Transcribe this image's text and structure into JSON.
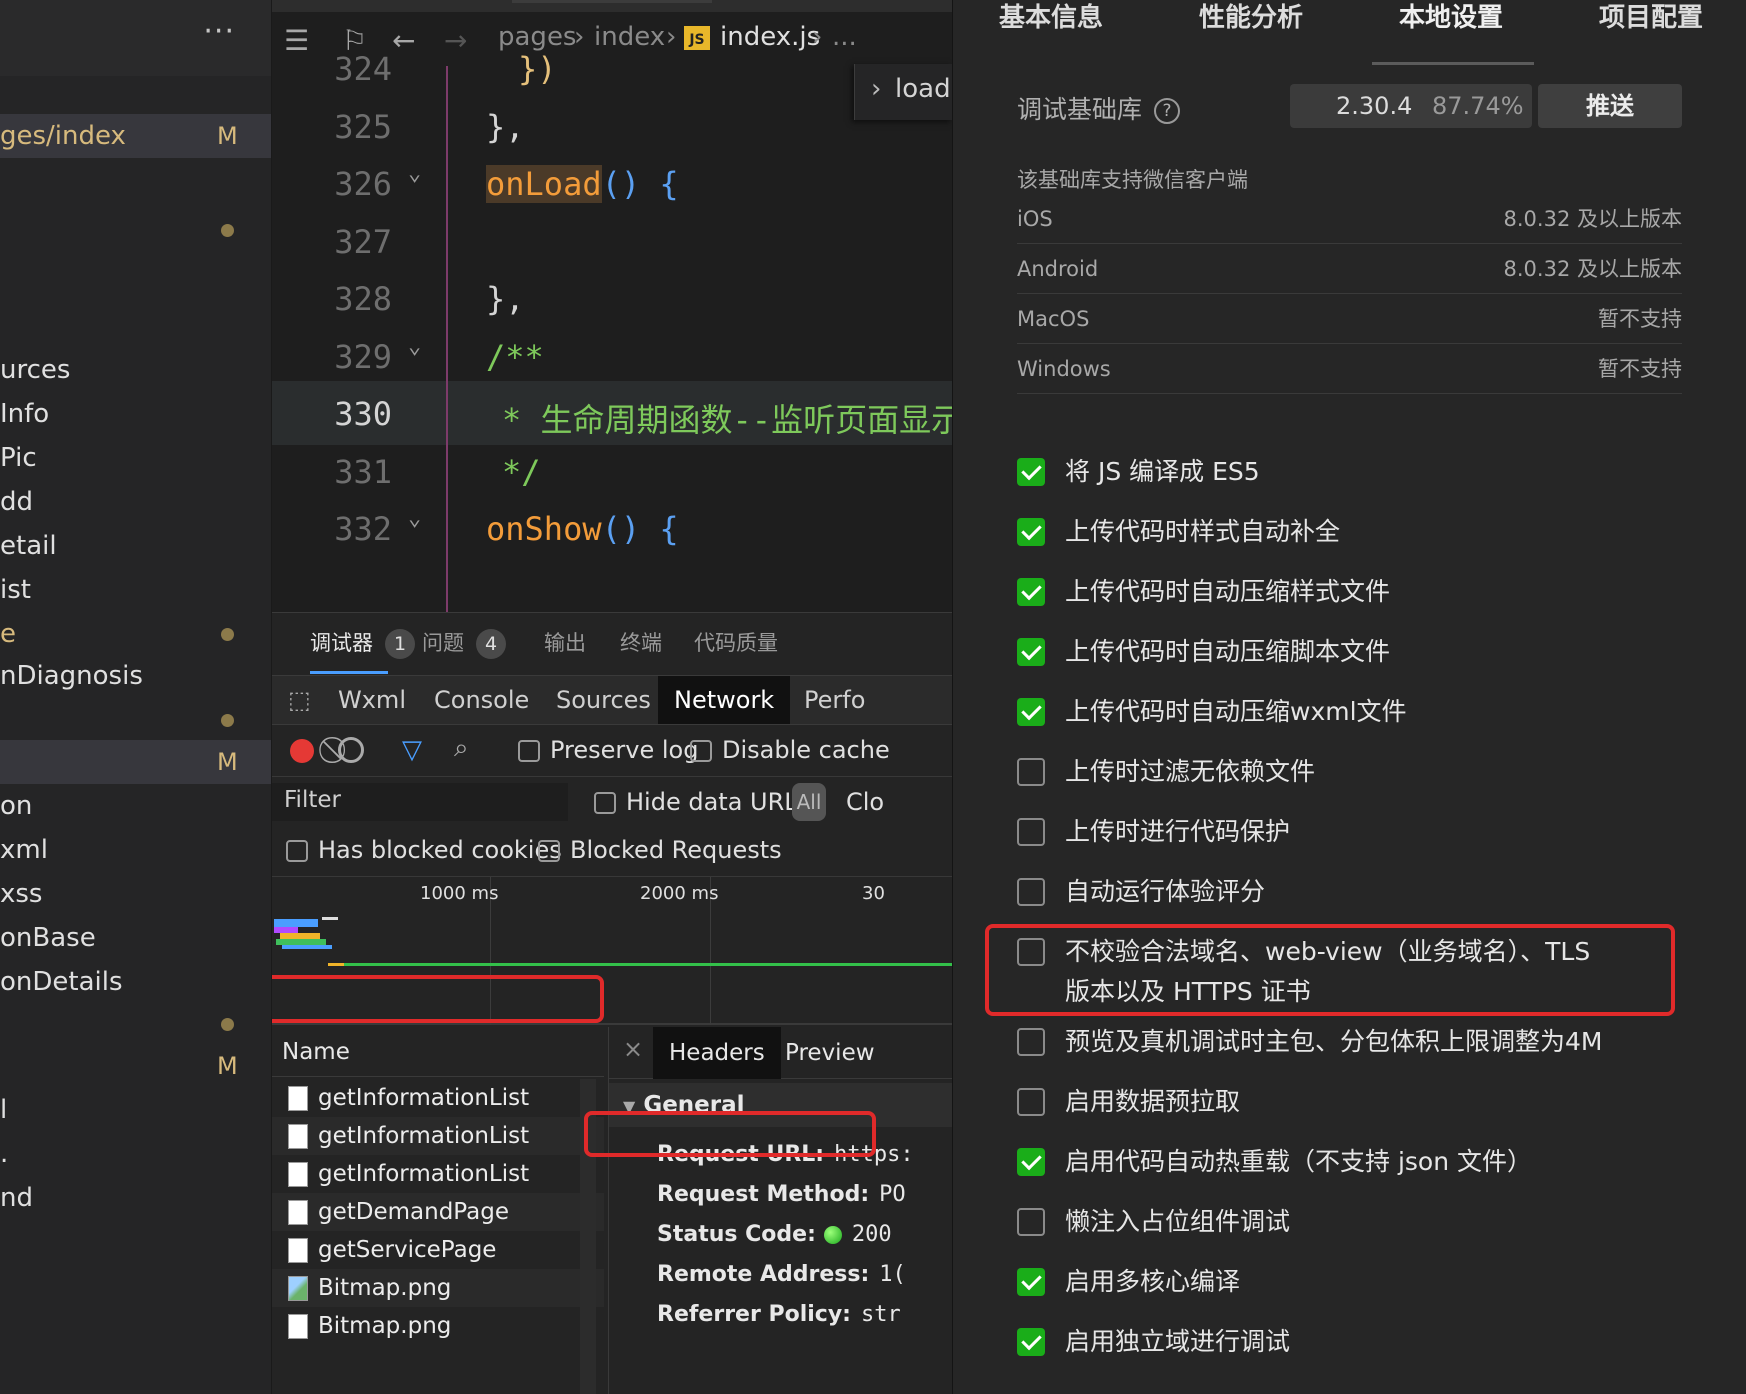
{
  "explorer": {
    "items": [
      {
        "label": "ges/index",
        "tag": "M",
        "dot": false,
        "highlight": true
      },
      {
        "label": "",
        "tag": "",
        "dot": true,
        "highlight": false
      },
      {
        "label": "urces",
        "tag": "",
        "dot": false
      },
      {
        "label": "Info",
        "tag": "",
        "dot": false
      },
      {
        "label": "Pic",
        "tag": "",
        "dot": false
      },
      {
        "label": "dd",
        "tag": "",
        "dot": false
      },
      {
        "label": "etail",
        "tag": "",
        "dot": false
      },
      {
        "label": "ist",
        "tag": "",
        "dot": false
      },
      {
        "label": "e",
        "tag": "",
        "dot": true
      },
      {
        "label": "nDiagnosis",
        "tag": "",
        "dot": false
      },
      {
        "label": "",
        "tag": "",
        "dot": true
      },
      {
        "label": "",
        "tag": "M",
        "dot": false,
        "highlight": true
      },
      {
        "label": "on",
        "tag": "",
        "dot": false
      },
      {
        "label": "xml",
        "tag": "",
        "dot": false
      },
      {
        "label": "xss",
        "tag": "",
        "dot": false
      },
      {
        "label": "onBase",
        "tag": "",
        "dot": false
      },
      {
        "label": "onDetails",
        "tag": "",
        "dot": false
      },
      {
        "label": "",
        "tag": "",
        "dot": true
      },
      {
        "label": "",
        "tag": "M",
        "dot": false
      },
      {
        "label": "l",
        "tag": "",
        "dot": false
      },
      {
        "label": ".",
        "tag": "",
        "dot": false
      },
      {
        "label": "nd",
        "tag": "",
        "dot": false
      }
    ],
    "more_label": "···"
  },
  "editor": {
    "breadcrumb": {
      "part1": "pages",
      "part2": "index",
      "js_badge": "JS",
      "file": "index.js",
      "ellipsis": "..."
    },
    "sticky": "load",
    "lines": [
      {
        "num": "324",
        "code": "})"
      },
      {
        "num": "325",
        "code": "},"
      },
      {
        "num": "326",
        "fn": "onLoad",
        "rest": "() {"
      },
      {
        "num": "327",
        "code": ""
      },
      {
        "num": "328",
        "code": "},"
      },
      {
        "num": "329",
        "comment": "/**"
      },
      {
        "num": "330",
        "comment": "* 生命周期函数--监听页面显示"
      },
      {
        "num": "331",
        "comment": "*/"
      },
      {
        "num": "332",
        "fn": "onShow",
        "rest": "() {"
      }
    ]
  },
  "panel": {
    "tabs": [
      {
        "label": "调试器",
        "badge": "1"
      },
      {
        "label": "问题",
        "badge": "4"
      },
      {
        "label": "输出",
        "badge": ""
      },
      {
        "label": "终端",
        "badge": ""
      },
      {
        "label": "代码质量",
        "badge": ""
      }
    ],
    "devtools_tabs": [
      "Wxml",
      "Console",
      "Sources",
      "Network",
      "Perfo"
    ],
    "active_devtools_tab": "Network",
    "toolbar": {
      "preserve_log": "Preserve log",
      "disable_cache": "Disable cache"
    },
    "filter": {
      "placeholder": "Filter",
      "hide_data_urls": "Hide data URLs",
      "all": "All",
      "clo": "Clo"
    },
    "blocked": {
      "cookies": "Has blocked cookies",
      "requests": "Blocked Requests"
    },
    "timeline_ticks": [
      "1000 ms",
      "2000 ms",
      "30"
    ],
    "table_header": "Name",
    "requests": [
      {
        "name": "getInformationList",
        "type": "doc"
      },
      {
        "name": "getInformationList",
        "type": "doc"
      },
      {
        "name": "getInformationList",
        "type": "doc"
      },
      {
        "name": "getDemandPage",
        "type": "doc"
      },
      {
        "name": "getServicePage",
        "type": "doc"
      },
      {
        "name": "Bitmap.png",
        "type": "img"
      },
      {
        "name": "Bitmap.png",
        "type": "doc"
      }
    ],
    "details": {
      "close": "×",
      "tabs": [
        "Headers",
        "Preview"
      ],
      "section": "General",
      "fields": [
        {
          "key": "Request URL:",
          "value": "https:"
        },
        {
          "key": "Request Method:",
          "value": "PO"
        },
        {
          "key": "Status Code:",
          "value": "200"
        },
        {
          "key": "Remote Address:",
          "value": "1("
        },
        {
          "key": "Referrer Policy:",
          "value": "str"
        }
      ]
    }
  },
  "settings": {
    "tabs": [
      "基本信息",
      "性能分析",
      "本地设置",
      "项目配置"
    ],
    "active_tab": "本地设置",
    "lib": {
      "label": "调试基础库",
      "help": "?",
      "version": "2.30.4",
      "percent": "87.74%",
      "push": "推送"
    },
    "support_title": "该基础库支持微信客户端",
    "platforms": [
      {
        "name": "iOS",
        "value": "8.0.32 及以上版本"
      },
      {
        "name": "Android",
        "value": "8.0.32 及以上版本"
      },
      {
        "name": "MacOS",
        "value": "暂不支持"
      },
      {
        "name": "Windows",
        "value": "暂不支持"
      }
    ],
    "options": [
      {
        "label": "将 JS 编译成 ES5",
        "checked": true
      },
      {
        "label": "上传代码时样式自动补全",
        "checked": true
      },
      {
        "label": "上传代码时自动压缩样式文件",
        "checked": true
      },
      {
        "label": "上传代码时自动压缩脚本文件",
        "checked": true
      },
      {
        "label": "上传代码时自动压缩wxml文件",
        "checked": true
      },
      {
        "label": "上传时过滤无依赖文件",
        "checked": false
      },
      {
        "label": "上传时进行代码保护",
        "checked": false
      },
      {
        "label": "自动运行体验评分",
        "checked": false
      },
      {
        "label": "不校验合法域名、web-view（业务域名）、TLS",
        "label2": "版本以及 HTTPS 证书",
        "checked": false
      },
      {
        "label": "预览及真机调试时主包、分包体积上限调整为4M",
        "checked": false
      },
      {
        "label": "启用数据预拉取",
        "checked": false
      },
      {
        "label": "启用代码自动热重载（不支持 json 文件）",
        "checked": true
      },
      {
        "label": "懒注入占位组件调试",
        "checked": false
      },
      {
        "label": "启用多核心编译",
        "checked": true
      },
      {
        "label": "启用独立域进行调试",
        "checked": true
      }
    ]
  },
  "colors": {
    "accent_green": "#1aad19",
    "highlight_red": "#e02a2a",
    "record_red": "#e53935",
    "filter_blue": "#4a9eff"
  }
}
